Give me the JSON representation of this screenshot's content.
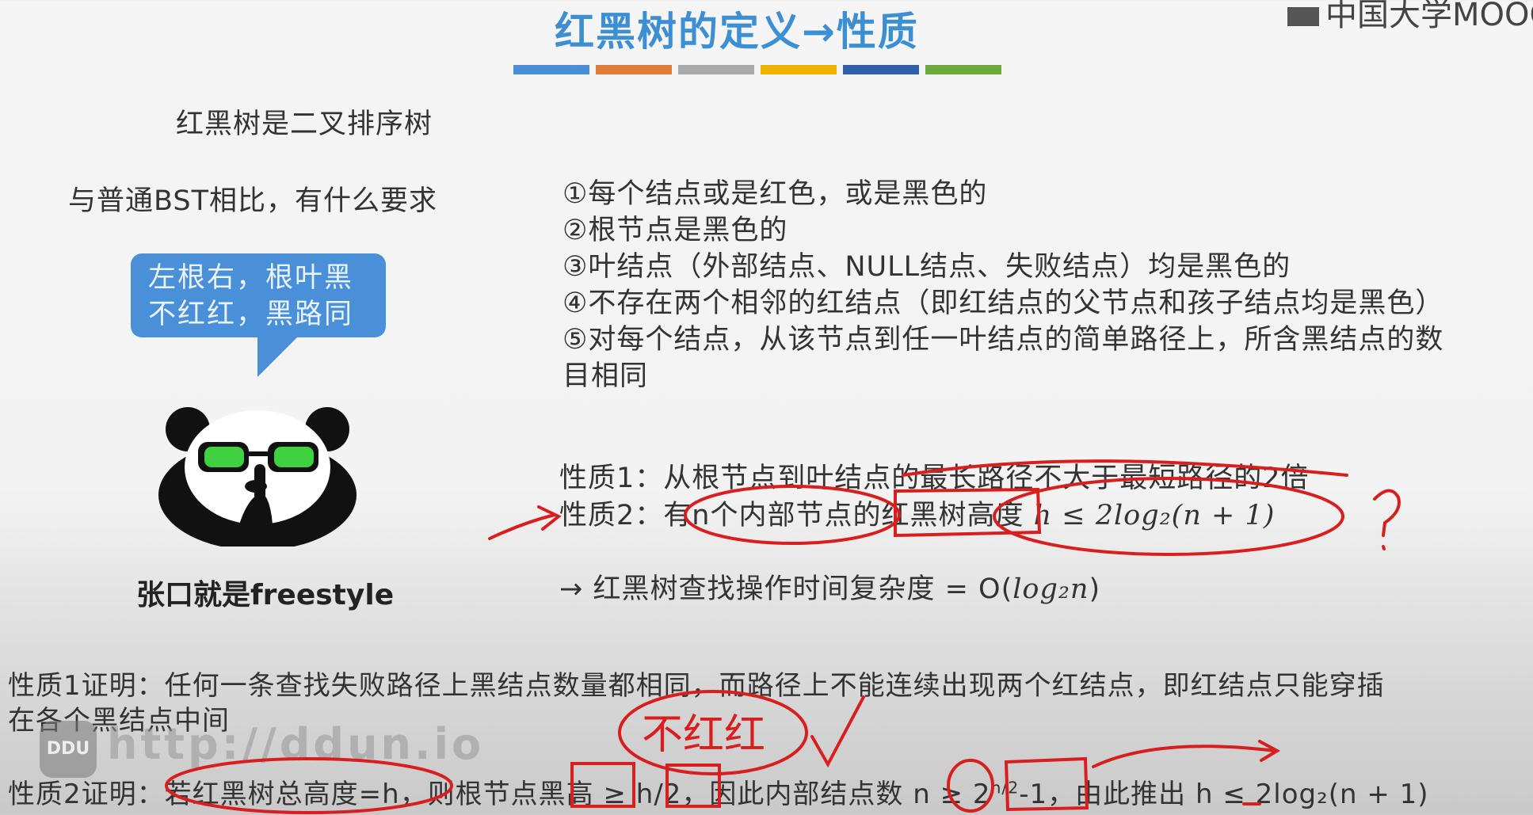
{
  "header": {
    "title": "红黑树的定义→性质",
    "watermark": "中国大学MOOC",
    "bar_colors": [
      "#4a90d9",
      "#e07b39",
      "#a9a9a9",
      "#f0b400",
      "#2f5fa8",
      "#6aaa3a"
    ]
  },
  "left": {
    "line1": "红黑树是二叉排序树",
    "line2": "与普通BST相比，有什么要求",
    "bubble_line1": "左根右，根叶黑",
    "bubble_line2": "不红红，黑路同",
    "caption": "张口就是freestyle"
  },
  "properties": [
    "①每个结点或是红色，或是黑色的",
    "②根节点是黑色的",
    "③叶结点（外部结点、NULL结点、失败结点）均是黑色的",
    "④不存在两个相邻的红结点（即红结点的父节点和孩子结点均是黑色）",
    "⑤对每个结点，从该节点到任一叶结点的简单路径上，所含黑结点的数",
    "目相同"
  ],
  "theorems": {
    "t1": "性质1：从根节点到叶结点的最长路径不大于最短路径的2倍",
    "t2_prefix": "性质2：有n个内部节点的红黑树高度",
    "t2_formula": "h ≤ 2log₂(n + 1)",
    "complexity_prefix": "→ 红黑树查找操作时间复杂度 = O(",
    "complexity_formula": "log₂n",
    "complexity_suffix": ")"
  },
  "proofs": {
    "p1_line1": "性质1证明：任何一条查找失败路径上黑结点数量都相同，而路径上不能连续出现两个红结点，即红结点只能穿插",
    "p1_line2": "在各个黑结点中间",
    "p2_a": "性质2证明：若红黑树总高度=h，则根节点黑高 ≥ h/2，因此内部结点数 n ≥ 2",
    "p2_sup": "h/2",
    "p2_b": "-1，由此推出 h ≤ 2log₂(n + 1)"
  },
  "annotations": {
    "handwritten_note": "不红红",
    "question_mark": "?"
  },
  "overlay_watermark": {
    "logo": "DDU",
    "url": "http://ddun.io"
  }
}
